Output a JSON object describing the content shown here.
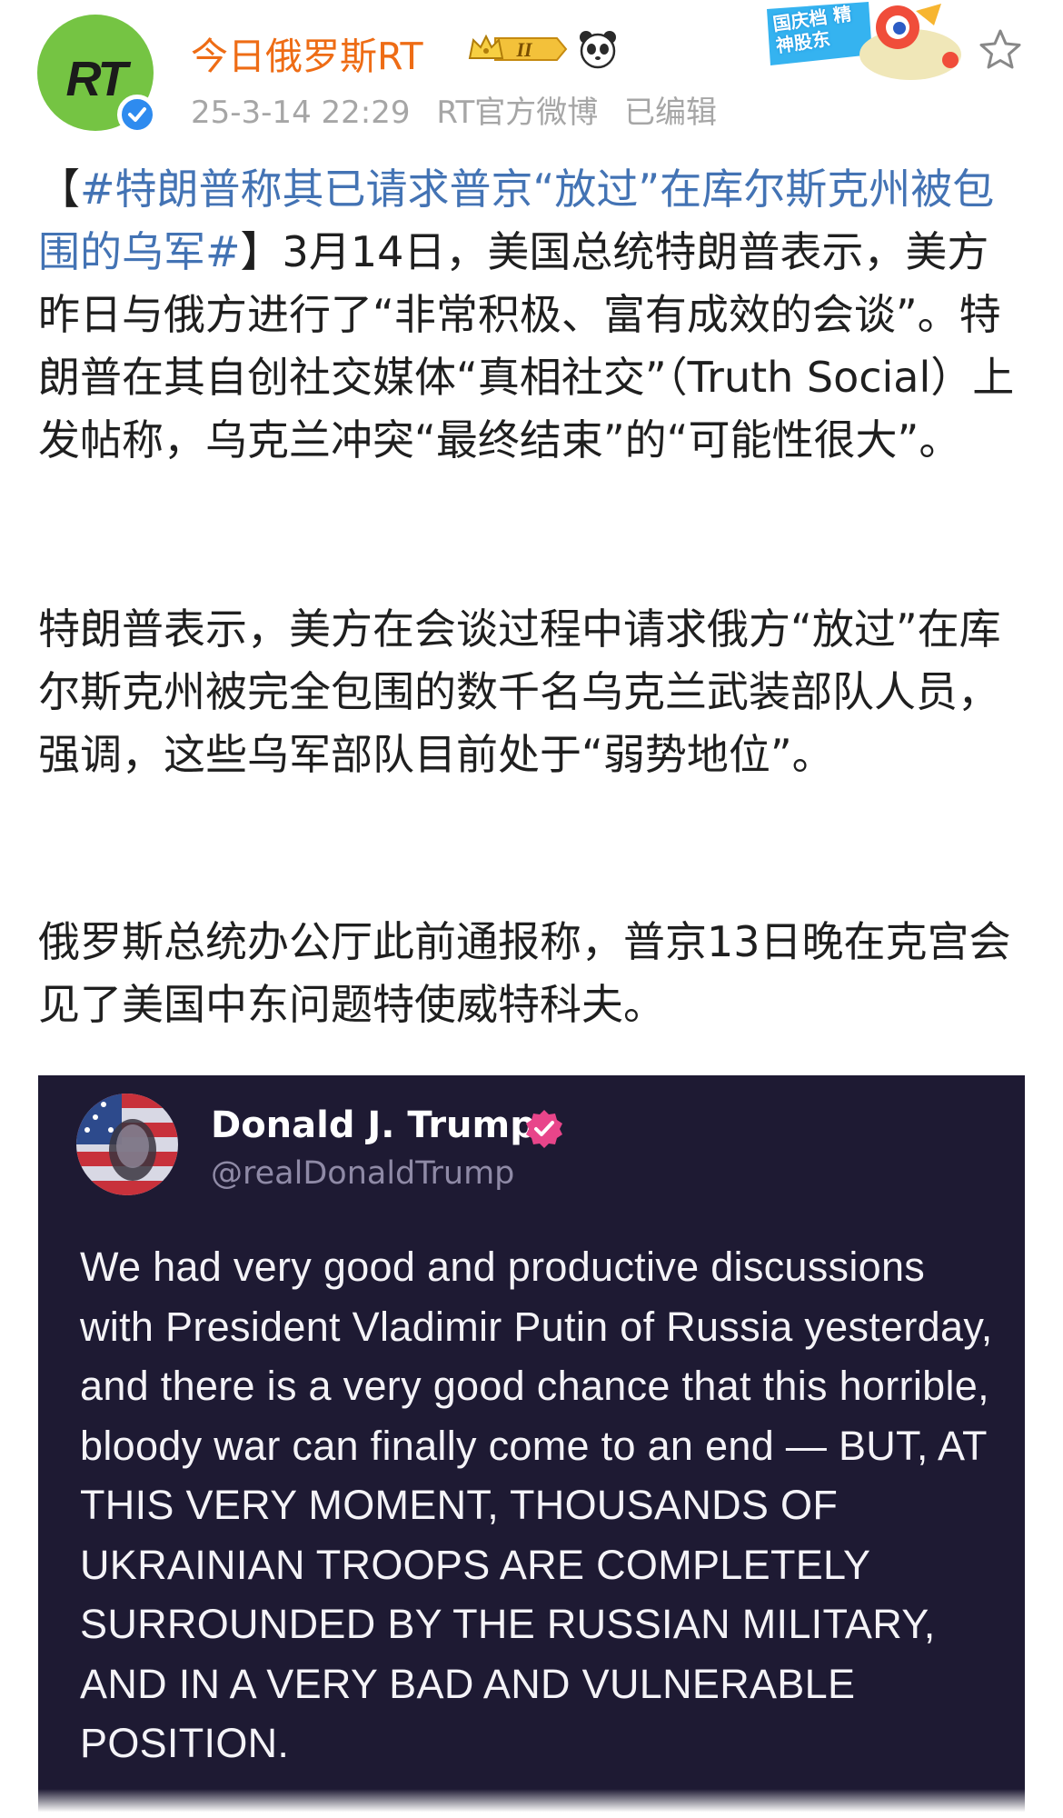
{
  "header": {
    "avatar_logo_text": "RT",
    "user_name": "今日俄罗斯RT",
    "vip_badge_text": "II",
    "timestamp": "25-3-14 22:29",
    "source": "RT官方微博",
    "edited_label": "已编辑",
    "promo_sticker_text": "国庆档 精神股东"
  },
  "post": {
    "p1_hashtag": "#特朗普称其已请求普京“放过”在库尔斯克州被包围的乌军#",
    "p1_open_bracket": "【",
    "p1_close_bracket": "】",
    "p1_text": "3月14日，美国总统特朗普表示，美方昨日与俄方进行了“非常积极、富有成效的会谈”。特朗普在其自创社交媒体“真相社交”（Truth Social）上发帖称，乌克兰冲突“最终结束”的“可能性很大”。",
    "p2": "特朗普表示，美方在会谈过程中请求俄方“放过”在库尔斯克州被完全包围的数千名乌克兰武装部队人员，强调，这些乌军部队目前处于“弱势地位”。",
    "p3": "俄罗斯总统办公厅此前通报称，普京13日晚在克宫会见了美国中东问题特使威特科夫。"
  },
  "embed": {
    "name": "Donald J. Trump",
    "handle": "@realDonaldTrump",
    "text": "We had very good and productive discussions with President Vladimir Putin of Russia yesterday, and there is a very good chance that this horrible, bloody war can finally come to an end — BUT, AT THIS VERY MOMENT, THOUSANDS OF UKRAINIAN TROOPS ARE COMPLETELY SURROUNDED BY THE RUSSIAN MILITARY, AND IN A VERY BAD AND VULNERABLE POSITION."
  },
  "colors": {
    "user_name": "#ee6c15",
    "hashtag": "#4373b4",
    "meta": "#a6a6a6",
    "avatar_bg": "#75c443",
    "verified": "#2e8bef",
    "embed_bg": "#1e1a33",
    "embed_check": "#e8458a"
  },
  "icons": {
    "verified": "verified-icon",
    "vip": "crown-vip-badge-icon",
    "panda": "panda-icon",
    "star": "star-outline-icon",
    "embed_verified": "pink-verified-check-icon"
  }
}
